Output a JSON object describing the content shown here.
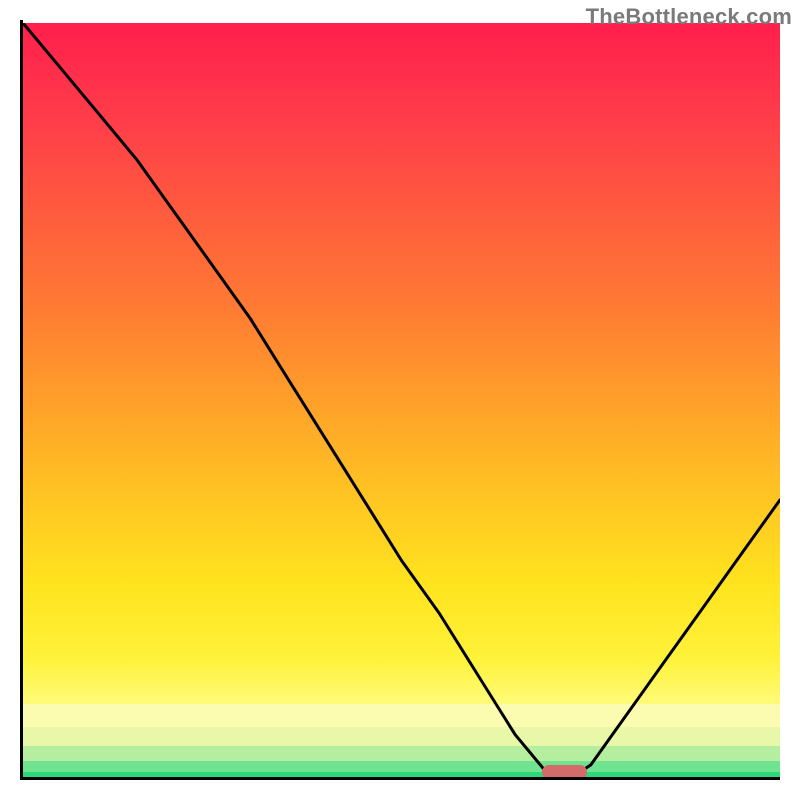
{
  "watermark": {
    "text": "TheBottleneck.com"
  },
  "colors": {
    "gradient_stops": [
      {
        "offset": 0.0,
        "color": "#ff1f4c"
      },
      {
        "offset": 0.12,
        "color": "#ff3b4a"
      },
      {
        "offset": 0.25,
        "color": "#ff5b3e"
      },
      {
        "offset": 0.38,
        "color": "#ff7c33"
      },
      {
        "offset": 0.5,
        "color": "#ffa02a"
      },
      {
        "offset": 0.62,
        "color": "#ffc323"
      },
      {
        "offset": 0.74,
        "color": "#ffe31e"
      },
      {
        "offset": 0.84,
        "color": "#fff23a"
      },
      {
        "offset": 0.9,
        "color": "#fffb7a"
      },
      {
        "offset": 0.95,
        "color": "#f8fca6"
      },
      {
        "offset": 1.0,
        "color": "#2fe07d"
      }
    ],
    "band_strips": [
      {
        "from": 0.9,
        "to": 0.93,
        "color": "#fcfcb0"
      },
      {
        "from": 0.93,
        "to": 0.955,
        "color": "#e8f7a8"
      },
      {
        "from": 0.955,
        "to": 0.975,
        "color": "#b6eea0"
      },
      {
        "from": 0.975,
        "to": 0.99,
        "color": "#6fe38f"
      },
      {
        "from": 0.99,
        "to": 1.0,
        "color": "#2bd87b"
      }
    ],
    "marker": "#d46a6a"
  },
  "chart_data": {
    "type": "line",
    "title": "",
    "xlabel": "",
    "ylabel": "",
    "xlim": [
      0,
      1
    ],
    "ylim": [
      0,
      1
    ],
    "x": [
      0.0,
      0.05,
      0.1,
      0.15,
      0.2,
      0.25,
      0.3,
      0.35,
      0.4,
      0.45,
      0.5,
      0.55,
      0.6,
      0.65,
      0.7,
      0.72,
      0.75,
      0.8,
      0.85,
      0.9,
      0.95,
      1.0
    ],
    "values": [
      1.0,
      0.94,
      0.88,
      0.82,
      0.75,
      0.68,
      0.61,
      0.53,
      0.45,
      0.37,
      0.29,
      0.22,
      0.14,
      0.06,
      0.0,
      0.0,
      0.02,
      0.09,
      0.16,
      0.23,
      0.3,
      0.37
    ],
    "annotations": [
      {
        "shape": "pill",
        "x0": 0.685,
        "x1": 0.745,
        "y": 0.01
      }
    ]
  }
}
